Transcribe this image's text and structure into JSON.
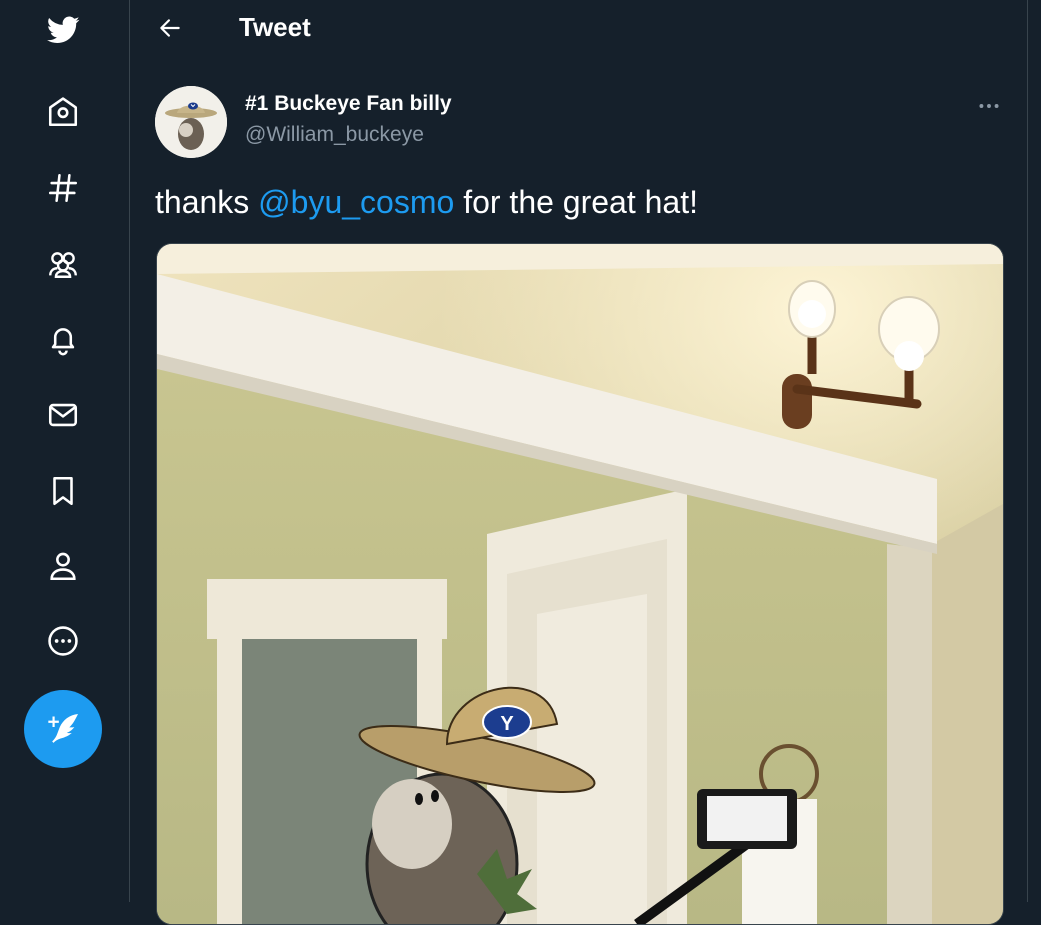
{
  "sidebar": {
    "items": [
      {
        "name": "logo",
        "icon": "twitter-bird-icon"
      },
      {
        "name": "home",
        "icon": "home-icon"
      },
      {
        "name": "explore",
        "icon": "hashtag-icon"
      },
      {
        "name": "communities",
        "icon": "communities-icon"
      },
      {
        "name": "notifications",
        "icon": "bell-icon"
      },
      {
        "name": "messages",
        "icon": "mail-icon"
      },
      {
        "name": "bookmarks",
        "icon": "bookmark-icon"
      },
      {
        "name": "profile",
        "icon": "person-icon"
      },
      {
        "name": "more",
        "icon": "more-circle-icon"
      }
    ],
    "compose_icon": "compose-feather-icon"
  },
  "header": {
    "back_icon": "arrow-left-icon",
    "title": "Tweet"
  },
  "tweet": {
    "display_name": "#1 Buckeye Fan billy",
    "handle": "@William_buckeye",
    "text_before": "thanks ",
    "mention": "@byu_cosmo",
    "text_after": " for the great hat!",
    "more_icon": "ellipsis-icon",
    "media": {
      "hat_logo": "Y"
    }
  },
  "colors": {
    "background": "#15202b",
    "border": "#38444d",
    "accent": "#1d9bf0",
    "secondary_text": "#8b98a5"
  }
}
